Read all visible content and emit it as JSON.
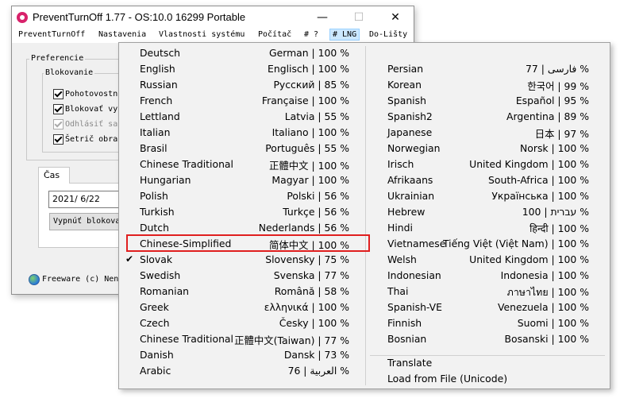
{
  "window": {
    "title": "PreventTurnOff 1.77 - OS:10.0 16299 Portable",
    "controls": {
      "minimize": "—",
      "maximize": "☐",
      "close": "✕"
    }
  },
  "menu": [
    {
      "label": "PreventTurnOff"
    },
    {
      "label": "Nastavenia"
    },
    {
      "label": "Vlastnosti systému"
    },
    {
      "label": "Počítač"
    },
    {
      "label": "# ?"
    },
    {
      "label": "# LNG"
    },
    {
      "label": "Do-Lišty"
    }
  ],
  "preferences": {
    "label": "Preferencie",
    "blocking": {
      "label": "Blokovanie",
      "items": [
        {
          "label": "Pohotovostn",
          "checked": true,
          "enabled": true
        },
        {
          "label": "Blokovať vyp",
          "checked": true,
          "enabled": true
        },
        {
          "label": "Odhlásiť sa",
          "checked": true,
          "enabled": false
        },
        {
          "label": "Šetrič obra",
          "checked": true,
          "enabled": true
        }
      ]
    }
  },
  "time_tab": {
    "label": "Čas",
    "date": "2021/ 6/22",
    "button": "Vypnúť blokova"
  },
  "footer": {
    "text": "Freeware (c) Nen"
  },
  "lang_menu": {
    "left": [
      {
        "name": "Deutsch",
        "value": "German | 100 %"
      },
      {
        "name": "English",
        "value": "Englisch | 100 %"
      },
      {
        "name": "Russian",
        "value": "Русский | 85 %"
      },
      {
        "name": "French",
        "value": "Française | 100 %"
      },
      {
        "name": "Lettland",
        "value": "Latvia | 55 %"
      },
      {
        "name": "Italian",
        "value": "Italiano | 100 %"
      },
      {
        "name": "Brasil",
        "value": "Português | 55 %"
      },
      {
        "name": "Chinese Traditional",
        "value": "正體中文 | 100 %"
      },
      {
        "name": "Hungarian",
        "value": "Magyar | 100 %"
      },
      {
        "name": "Polish",
        "value": "Polski | 56 %"
      },
      {
        "name": "Turkish",
        "value": "Turkçe | 56 %"
      },
      {
        "name": "Dutch",
        "value": "Nederlands | 56 %"
      },
      {
        "name": "Chinese-Simplified",
        "value": "简体中文 | 100 %"
      },
      {
        "name": "Slovak",
        "value": "Slovensky | 75 %",
        "checked": true
      },
      {
        "name": "Swedish",
        "value": "Svenska | 77 %"
      },
      {
        "name": "Romanian",
        "value": "Română | 58 %"
      },
      {
        "name": "Greek",
        "value": "ελληνικά | 100 %"
      },
      {
        "name": "Czech",
        "value": "Česky | 100 %"
      },
      {
        "name": "Chinese Traditional",
        "value": "正體中文(Taiwan) | 77 %"
      },
      {
        "name": "Danish",
        "value": "Dansk | 73 %"
      },
      {
        "name": "Arabic",
        "value": "76 | العربية %"
      }
    ],
    "right": [
      {
        "name": "Persian",
        "value": "77 | فارسی %"
      },
      {
        "name": "Korean",
        "value": "한국어 | 99 %"
      },
      {
        "name": "Spanish",
        "value": "Español | 95 %"
      },
      {
        "name": "Spanish2",
        "value": "Argentina | 89 %"
      },
      {
        "name": "Japanese",
        "value": "日本 | 97 %"
      },
      {
        "name": "Norwegian",
        "value": "Norsk | 100 %"
      },
      {
        "name": "Irisch",
        "value": "United Kingdom | 100 %"
      },
      {
        "name": "Afrikaans",
        "value": "South-Africa | 100 %"
      },
      {
        "name": "Ukrainian",
        "value": "Українська | 100 %"
      },
      {
        "name": "Hebrew",
        "value": "100 | עברית %"
      },
      {
        "name": "Hindi",
        "value": "हिन्दी | 100 %"
      },
      {
        "name": "Vietnamese",
        "value": "Tiếng Việt (Việt Nam) | 100 %"
      },
      {
        "name": "Welsh",
        "value": "United Kingdom | 100 %"
      },
      {
        "name": "Indonesian",
        "value": "Indonesia | 100 %"
      },
      {
        "name": "Thai",
        "value": "ภาษาไทย | 100 %"
      },
      {
        "name": "Spanish-VE",
        "value": "Venezuela | 100 %"
      },
      {
        "name": "Finnish",
        "value": "Suomi | 100 %"
      },
      {
        "name": "Bosnian",
        "value": "Bosanski | 100 %"
      }
    ],
    "actions": [
      {
        "label": "Translate"
      },
      {
        "label": "Load from File (Unicode)"
      }
    ],
    "check_mark": "✔"
  },
  "colors": {
    "highlight_border": "#e01f1f",
    "active_menu_bg": "#cce8ff",
    "app_icon": "#d8226b"
  }
}
